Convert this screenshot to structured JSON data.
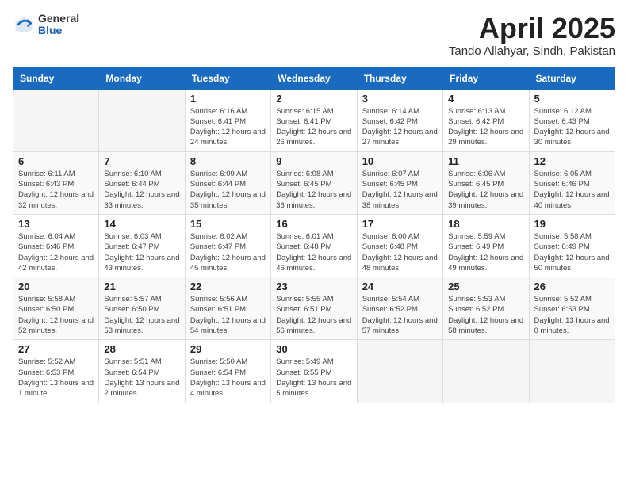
{
  "logo": {
    "general": "General",
    "blue": "Blue"
  },
  "header": {
    "title": "April 2025",
    "subtitle": "Tando Allahyar, Sindh, Pakistan"
  },
  "weekdays": [
    "Sunday",
    "Monday",
    "Tuesday",
    "Wednesday",
    "Thursday",
    "Friday",
    "Saturday"
  ],
  "weeks": [
    [
      {
        "day": "",
        "info": ""
      },
      {
        "day": "",
        "info": ""
      },
      {
        "day": "1",
        "info": "Sunrise: 6:16 AM\nSunset: 6:41 PM\nDaylight: 12 hours\nand 24 minutes."
      },
      {
        "day": "2",
        "info": "Sunrise: 6:15 AM\nSunset: 6:41 PM\nDaylight: 12 hours\nand 26 minutes."
      },
      {
        "day": "3",
        "info": "Sunrise: 6:14 AM\nSunset: 6:42 PM\nDaylight: 12 hours\nand 27 minutes."
      },
      {
        "day": "4",
        "info": "Sunrise: 6:13 AM\nSunset: 6:42 PM\nDaylight: 12 hours\nand 29 minutes."
      },
      {
        "day": "5",
        "info": "Sunrise: 6:12 AM\nSunset: 6:43 PM\nDaylight: 12 hours\nand 30 minutes."
      }
    ],
    [
      {
        "day": "6",
        "info": "Sunrise: 6:11 AM\nSunset: 6:43 PM\nDaylight: 12 hours\nand 32 minutes."
      },
      {
        "day": "7",
        "info": "Sunrise: 6:10 AM\nSunset: 6:44 PM\nDaylight: 12 hours\nand 33 minutes."
      },
      {
        "day": "8",
        "info": "Sunrise: 6:09 AM\nSunset: 6:44 PM\nDaylight: 12 hours\nand 35 minutes."
      },
      {
        "day": "9",
        "info": "Sunrise: 6:08 AM\nSunset: 6:45 PM\nDaylight: 12 hours\nand 36 minutes."
      },
      {
        "day": "10",
        "info": "Sunrise: 6:07 AM\nSunset: 6:45 PM\nDaylight: 12 hours\nand 38 minutes."
      },
      {
        "day": "11",
        "info": "Sunrise: 6:06 AM\nSunset: 6:45 PM\nDaylight: 12 hours\nand 39 minutes."
      },
      {
        "day": "12",
        "info": "Sunrise: 6:05 AM\nSunset: 6:46 PM\nDaylight: 12 hours\nand 40 minutes."
      }
    ],
    [
      {
        "day": "13",
        "info": "Sunrise: 6:04 AM\nSunset: 6:46 PM\nDaylight: 12 hours\nand 42 minutes."
      },
      {
        "day": "14",
        "info": "Sunrise: 6:03 AM\nSunset: 6:47 PM\nDaylight: 12 hours\nand 43 minutes."
      },
      {
        "day": "15",
        "info": "Sunrise: 6:02 AM\nSunset: 6:47 PM\nDaylight: 12 hours\nand 45 minutes."
      },
      {
        "day": "16",
        "info": "Sunrise: 6:01 AM\nSunset: 6:48 PM\nDaylight: 12 hours\nand 46 minutes."
      },
      {
        "day": "17",
        "info": "Sunrise: 6:00 AM\nSunset: 6:48 PM\nDaylight: 12 hours\nand 48 minutes."
      },
      {
        "day": "18",
        "info": "Sunrise: 5:59 AM\nSunset: 6:49 PM\nDaylight: 12 hours\nand 49 minutes."
      },
      {
        "day": "19",
        "info": "Sunrise: 5:58 AM\nSunset: 6:49 PM\nDaylight: 12 hours\nand 50 minutes."
      }
    ],
    [
      {
        "day": "20",
        "info": "Sunrise: 5:58 AM\nSunset: 6:50 PM\nDaylight: 12 hours\nand 52 minutes."
      },
      {
        "day": "21",
        "info": "Sunrise: 5:57 AM\nSunset: 6:50 PM\nDaylight: 12 hours\nand 53 minutes."
      },
      {
        "day": "22",
        "info": "Sunrise: 5:56 AM\nSunset: 6:51 PM\nDaylight: 12 hours\nand 54 minutes."
      },
      {
        "day": "23",
        "info": "Sunrise: 5:55 AM\nSunset: 6:51 PM\nDaylight: 12 hours\nand 56 minutes."
      },
      {
        "day": "24",
        "info": "Sunrise: 5:54 AM\nSunset: 6:52 PM\nDaylight: 12 hours\nand 57 minutes."
      },
      {
        "day": "25",
        "info": "Sunrise: 5:53 AM\nSunset: 6:52 PM\nDaylight: 12 hours\nand 58 minutes."
      },
      {
        "day": "26",
        "info": "Sunrise: 5:52 AM\nSunset: 6:53 PM\nDaylight: 13 hours\nand 0 minutes."
      }
    ],
    [
      {
        "day": "27",
        "info": "Sunrise: 5:52 AM\nSunset: 6:53 PM\nDaylight: 13 hours\nand 1 minute."
      },
      {
        "day": "28",
        "info": "Sunrise: 5:51 AM\nSunset: 6:54 PM\nDaylight: 13 hours\nand 2 minutes."
      },
      {
        "day": "29",
        "info": "Sunrise: 5:50 AM\nSunset: 6:54 PM\nDaylight: 13 hours\nand 4 minutes."
      },
      {
        "day": "30",
        "info": "Sunrise: 5:49 AM\nSunset: 6:55 PM\nDaylight: 13 hours\nand 5 minutes."
      },
      {
        "day": "",
        "info": ""
      },
      {
        "day": "",
        "info": ""
      },
      {
        "day": "",
        "info": ""
      }
    ]
  ]
}
